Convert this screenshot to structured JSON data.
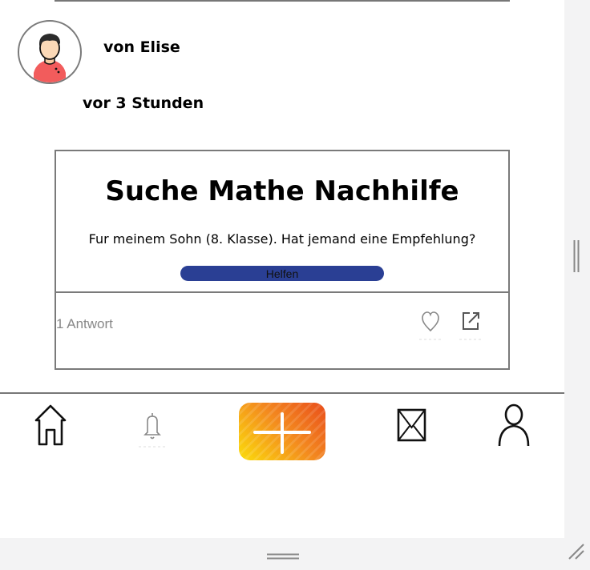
{
  "post": {
    "author": "von Elise",
    "time_ago": "vor 3 Stunden",
    "title": "Suche Mathe Nachhilfe",
    "body": "Fur meinem Sohn (8. Klasse). Hat jemand eine Empfehlung?",
    "help_button_label": "Helfen",
    "replies": "1 Antwort"
  },
  "nav": {
    "items": [
      "home-icon",
      "bell-icon",
      "add-icon",
      "mail-icon",
      "profile-icon"
    ]
  },
  "colors": {
    "help_button": "#2a3f94",
    "add_gradient_start": "#e94e1b",
    "add_gradient_end": "#fbdd0b",
    "border": "#7a7a7a",
    "scrollbar": "#f3f3f4"
  }
}
